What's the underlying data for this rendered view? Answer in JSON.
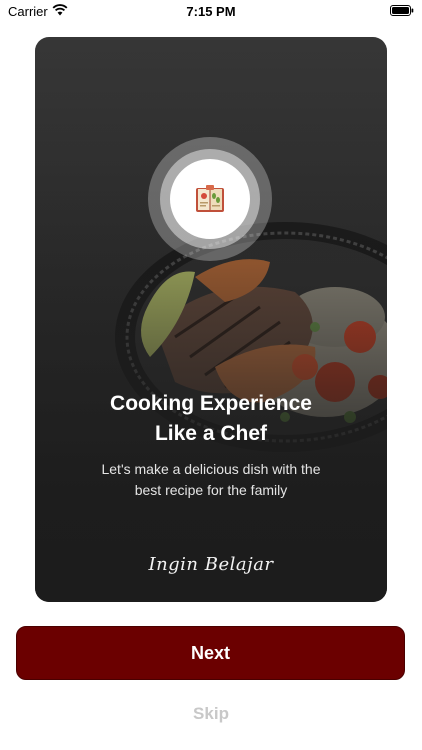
{
  "status_bar": {
    "carrier": "Carrier",
    "time": "7:15 PM",
    "wifi_icon": "wifi-icon",
    "battery_icon": "battery-icon"
  },
  "onboarding": {
    "logo_icon": "recipe-book-icon",
    "headline_line1": "Cooking Experience",
    "headline_line2": "Like a Chef",
    "subtitle_line1": "Let's make a delicious dish with the",
    "subtitle_line2": "best recipe for the family",
    "brand_name": "Ingin Belajar"
  },
  "actions": {
    "next_label": "Next",
    "skip_label": "Skip"
  },
  "colors": {
    "primary": "#6b0000",
    "skip_text": "#c8c8c8",
    "card_bg": "#2a2a2a"
  }
}
